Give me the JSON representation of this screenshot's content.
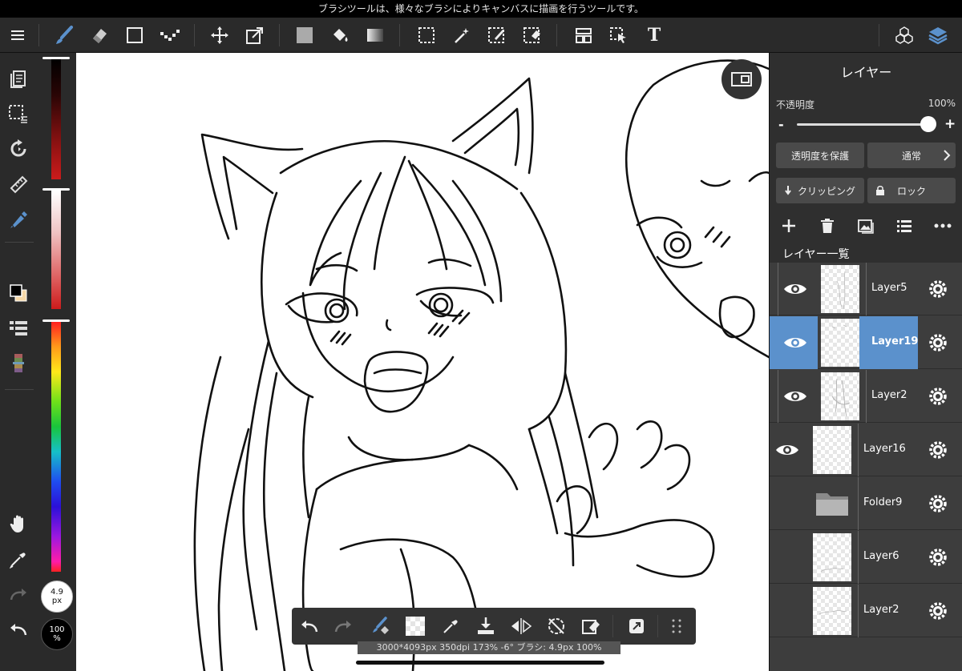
{
  "tooltip": "ブラシツールは、様々なブラシによりキャンバスに描画を行うツールです。",
  "toolbar": {
    "tools": [
      "menu-icon",
      "brush-icon",
      "eraser-icon",
      "rect-shape-icon",
      "dotted-brush-icon",
      "move-icon",
      "transform-icon",
      "fill-color-icon",
      "bucket-icon",
      "gradient-icon",
      "select-rect-icon",
      "magic-wand-icon",
      "select-pen-icon",
      "select-eraser-icon",
      "frame-icon",
      "operation-icon",
      "text-icon",
      "3d-icon",
      "layers-icon"
    ],
    "text_tool_label": "T"
  },
  "sidebar": {
    "tools": [
      "page-icon",
      "selection-icon",
      "rotate-icon",
      "ruler-icon",
      "pen-icon",
      "color-swatch-icon",
      "layer-list-icon",
      "palette-icon",
      "hand-icon",
      "eyedropper-icon",
      "redo-icon",
      "undo-icon"
    ]
  },
  "brush": {
    "size_value": "4.9",
    "size_unit": "px",
    "opacity_value": "100",
    "opacity_unit": "%"
  },
  "colors": {
    "accent": "#5b91cc",
    "primary": "#000000",
    "secondary": "#f6d8a8",
    "red_bar": "#cc1b1b"
  },
  "panel": {
    "title": "レイヤー",
    "opacity_label": "不透明度",
    "opacity_value": "100%",
    "opacity_fraction": 1.0,
    "minus": "-",
    "plus": "+",
    "protect_alpha": "透明度を保護",
    "blend_mode": "通常",
    "clipping": "クリッピング",
    "lock": "ロック",
    "list_title": "レイヤー一覧",
    "layers": [
      {
        "name": "Layer5",
        "visible": true,
        "selected": false,
        "type": "layer"
      },
      {
        "name": "Layer19",
        "visible": true,
        "selected": true,
        "type": "layer"
      },
      {
        "name": "Layer2",
        "visible": true,
        "selected": false,
        "type": "layer"
      },
      {
        "name": "Layer16",
        "visible": true,
        "selected": false,
        "type": "layer"
      },
      {
        "name": "Folder9",
        "visible": false,
        "selected": false,
        "type": "folder"
      },
      {
        "name": "Layer6",
        "visible": false,
        "selected": false,
        "type": "layer"
      },
      {
        "name": "Layer2",
        "visible": false,
        "selected": false,
        "type": "layer"
      }
    ]
  },
  "quickbar": {
    "status": "3000*4093px 350dpi 173% -6° ブラシ: 4.9px 100%"
  }
}
